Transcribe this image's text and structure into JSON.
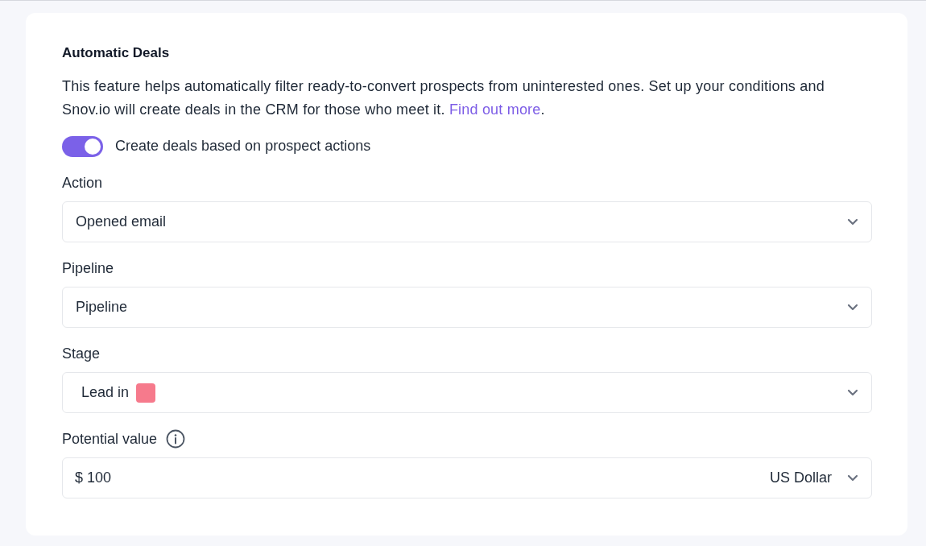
{
  "title": "Automatic Deals",
  "description": {
    "text": "This feature helps automatically filter ready-to-convert prospects from uninterested ones. Set up your conditions and Snov.io will create deals in the CRM for those who meet it.",
    "link": "Find out more",
    "after": "."
  },
  "toggle": {
    "label": "Create deals based on prospect actions",
    "on": true
  },
  "fields": [
    {
      "kind": "select",
      "label": "Action",
      "value": "Opened email"
    },
    {
      "kind": "select",
      "label": "Pipeline",
      "value": "Pipeline"
    },
    {
      "kind": "stage",
      "label": "Stage",
      "value": "Lead in",
      "color": "#f67a8c"
    },
    {
      "kind": "money",
      "label": "Potential value",
      "info": true,
      "value": "$ 100",
      "currency": "US Dollar"
    }
  ]
}
